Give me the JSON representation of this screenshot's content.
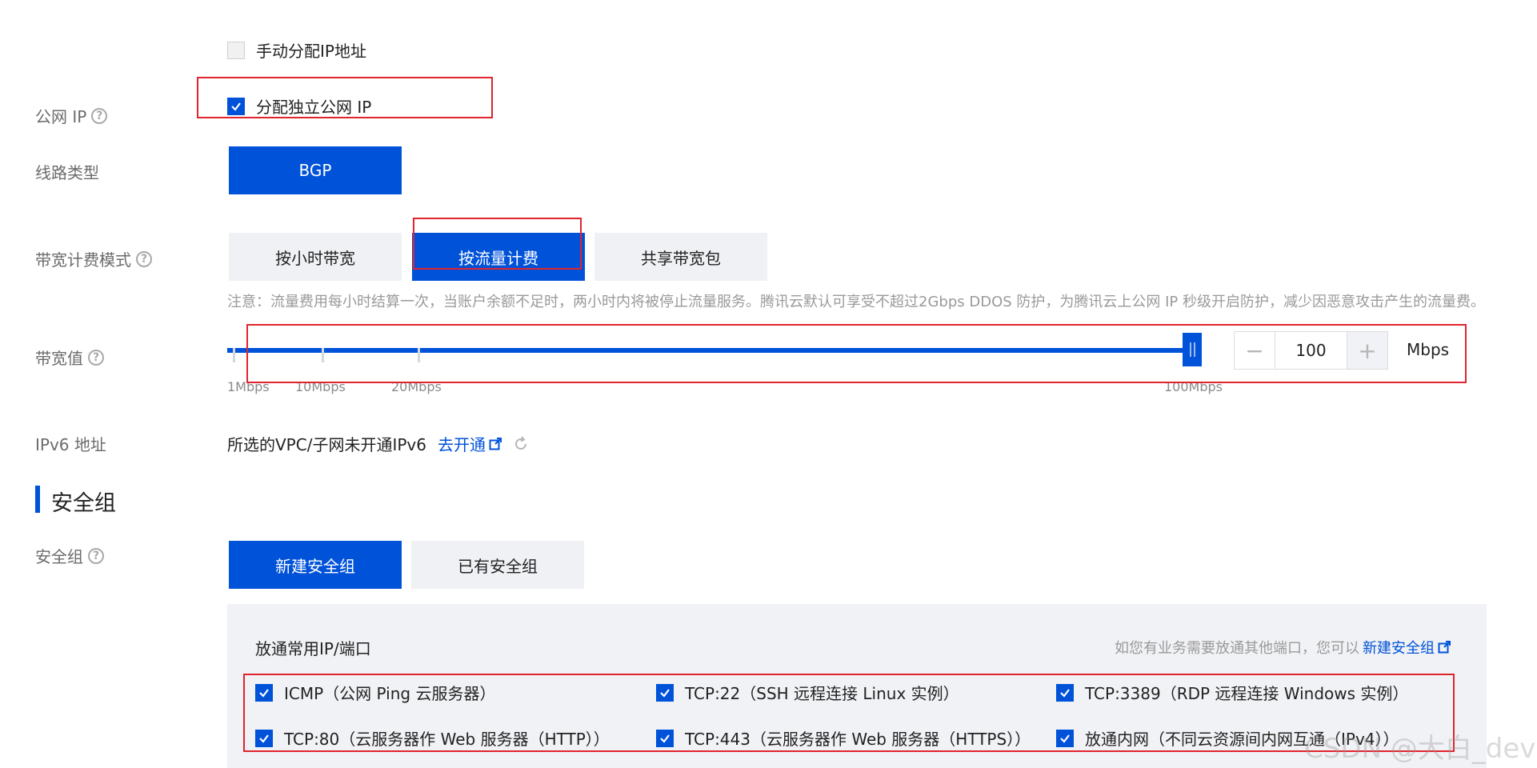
{
  "manual_ip": {
    "label": "手动分配IP地址",
    "checked": false
  },
  "public_ip": {
    "label": "公网 IP",
    "checkbox_label": "分配独立公网 IP",
    "checked": true
  },
  "line_type": {
    "label": "线路类型",
    "option": "BGP"
  },
  "billing_mode": {
    "label": "带宽计费模式",
    "options": [
      "按小时带宽",
      "按流量计费",
      "共享带宽包"
    ],
    "selected": "按流量计费",
    "note": "注意：流量费用每小时结算一次，当账户余额不足时，两小时内将被停止流量服务。腾讯云默认可享受不超过2Gbps DDOS 防护，为腾讯云上公网 IP 秒级开启防护，减少因恶意攻击产生的流量费。"
  },
  "bandwidth": {
    "label": "带宽值",
    "value": "100",
    "unit": "Mbps",
    "slider_fraction": 1.0,
    "tick_labels": [
      "1Mbps",
      "10Mbps",
      "20Mbps",
      "100Mbps"
    ],
    "minus": "−",
    "plus": "+"
  },
  "ipv6": {
    "label": "IPv6 地址",
    "text": "所选的VPC/子网未开通IPv6",
    "link": "去开通"
  },
  "security_group_section": {
    "title": "安全组"
  },
  "security_group": {
    "label": "安全组",
    "options": [
      "新建安全组",
      "已有安全组"
    ],
    "selected": "新建安全组",
    "panel_title": "放通常用IP/端口",
    "panel_hint": "如您有业务需要放通其他端口，您可以",
    "panel_link": "新建安全组",
    "ports": [
      {
        "label": "ICMP（公网 Ping 云服务器）",
        "checked": true
      },
      {
        "label": "TCP:22（SSH 远程连接 Linux 实例）",
        "checked": true
      },
      {
        "label": "TCP:3389（RDP 远程连接 Windows 实例）",
        "checked": true
      },
      {
        "label": "TCP:80（云服务器作 Web 服务器（HTTP））",
        "checked": true
      },
      {
        "label": "TCP:443（云服务器作 Web 服务器（HTTPS））",
        "checked": true
      },
      {
        "label": "放通内网（不同云资源间内网互通（IPv4））",
        "checked": true
      }
    ]
  },
  "watermark": "CSDN @大白_dev",
  "colors": {
    "primary": "#0052d9",
    "highlight_border": "#e0242e"
  }
}
